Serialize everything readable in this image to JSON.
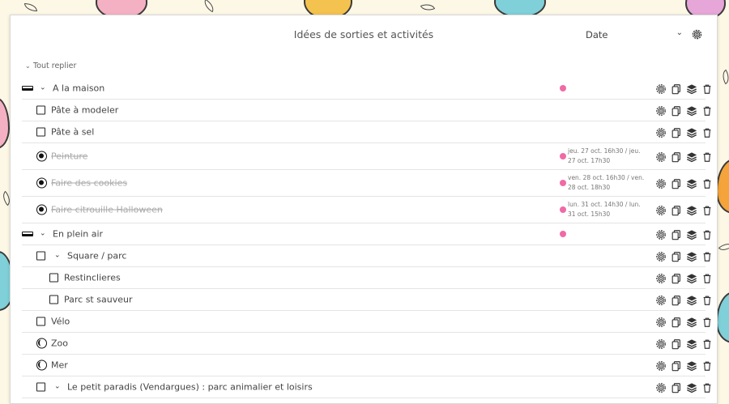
{
  "header": {
    "title": "Idées de sorties et activités",
    "sort_value": "Date"
  },
  "collapse_all": "Tout replier",
  "rows": [
    {
      "kind": "group",
      "label": "A la maison",
      "dot": true,
      "level": 0
    },
    {
      "kind": "check",
      "label": "Pâte à modeler",
      "level": 1
    },
    {
      "kind": "check",
      "label": "Pâte à sel",
      "level": 1
    },
    {
      "kind": "done",
      "label": "Peinture",
      "level": 1,
      "date": "jeu. 27 oct. 16h30 / jeu. 27 oct. 17h30"
    },
    {
      "kind": "done",
      "label": "Faire des cookies",
      "level": 1,
      "date": "ven. 28 oct. 16h30 / ven. 28 oct. 18h30"
    },
    {
      "kind": "done",
      "label": "Faire citrouille Halloween",
      "level": 1,
      "date": "lun. 31 oct. 14h30 / lun. 31 oct. 15h30"
    },
    {
      "kind": "group",
      "label": "En plein air",
      "dot": true,
      "level": 0
    },
    {
      "kind": "subgroup",
      "label": "Square / parc",
      "level": 1
    },
    {
      "kind": "check",
      "label": "Restinclieres",
      "level": 2
    },
    {
      "kind": "check",
      "label": "Parc st sauveur",
      "level": 2
    },
    {
      "kind": "check",
      "label": "Vélo",
      "level": 1
    },
    {
      "kind": "half",
      "label": "Zoo",
      "level": 1
    },
    {
      "kind": "half",
      "label": "Mer",
      "level": 1
    },
    {
      "kind": "subgroup",
      "label": "Le petit paradis (Vendargues) : parc animalier et loisirs",
      "level": 1
    }
  ],
  "icons": [
    "gear-icon",
    "copy-icon",
    "layers-icon",
    "trash-icon"
  ],
  "colors": {
    "accent_dot": "#f06aa5",
    "background": "#fdf7e6"
  }
}
